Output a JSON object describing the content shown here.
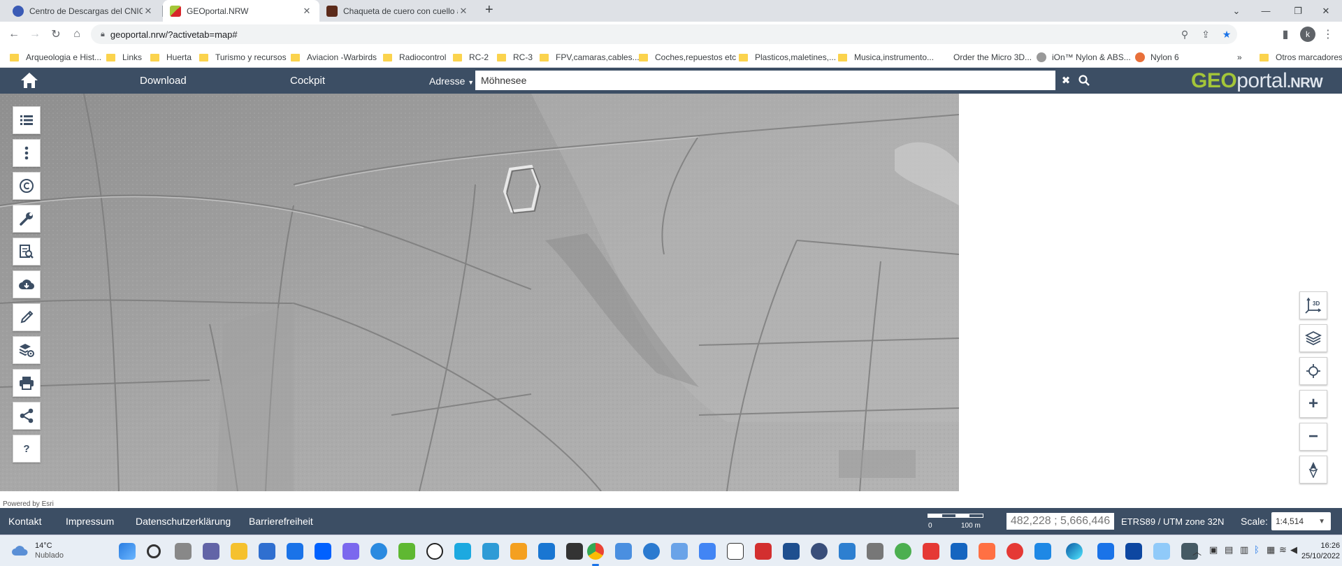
{
  "browser": {
    "tabs": [
      {
        "title": "Centro de Descargas del CNIG (I",
        "active": false
      },
      {
        "title": "GEOportal.NRW",
        "active": true
      },
      {
        "title": "Chaqueta de cuero con cuello alt",
        "active": false
      }
    ],
    "new_tab": "+",
    "url": "geoportal.nrw/?activetab=map#",
    "profile_initial": "k",
    "bookmarks": [
      "Arqueologia e Hist...",
      "Links",
      "Huerta",
      "Turismo y recursos",
      "Aviacion -Warbirds",
      "Radiocontrol",
      "RC-2",
      "RC-3",
      "FPV,camaras,cables...",
      "Coches,repuestos etc",
      "Plasticos,maletines,...",
      "Musica,instrumento...",
      "Order the Micro 3D...",
      "iOn™ Nylon & ABS...",
      "Nylon 6"
    ],
    "bookmarks_more": "»",
    "other_bookmarks": "Otros marcadores"
  },
  "header": {
    "nav": [
      "Download",
      "Cockpit"
    ],
    "search_mode": "Adresse",
    "search_value": "Möhnesee",
    "logo": {
      "geo": "GEO",
      "portal": "portal",
      "nrw": ".NRW"
    }
  },
  "map": {
    "left_tools": [
      "list-icon",
      "more-vertical-icon",
      "copyright-icon",
      "wrench-icon",
      "search-document-icon",
      "cloud-download-icon",
      "pencil-icon",
      "layers-settings-icon",
      "print-icon",
      "share-icon",
      "help-icon"
    ],
    "help_label": "?",
    "right_tools": [
      "3d-view-icon",
      "layers-icon",
      "locate-icon",
      "zoom-in-icon",
      "zoom-out-icon",
      "compass-icon"
    ],
    "three_d_label": "3D",
    "zoom_in": "+",
    "zoom_out": "−",
    "powered_by": "Powered by Esri"
  },
  "footer": {
    "links": [
      "Kontakt",
      "Impressum",
      "Datenschutzerklärung",
      "Barrierefreiheit"
    ],
    "scale_start": "0",
    "scale_end": "100 m",
    "coordinates": "482,228 ; 5,666,446",
    "projection": "ETRS89 / UTM zone 32N",
    "scale_label": "Scale:",
    "scale_value": "1:4,514"
  },
  "taskbar": {
    "temperature": "14°C",
    "weather": "Nublado",
    "time": "16:26",
    "date": "25/10/2022"
  },
  "colors": {
    "header_bg": "#3c4e64",
    "logo_green": "#a4c639"
  }
}
